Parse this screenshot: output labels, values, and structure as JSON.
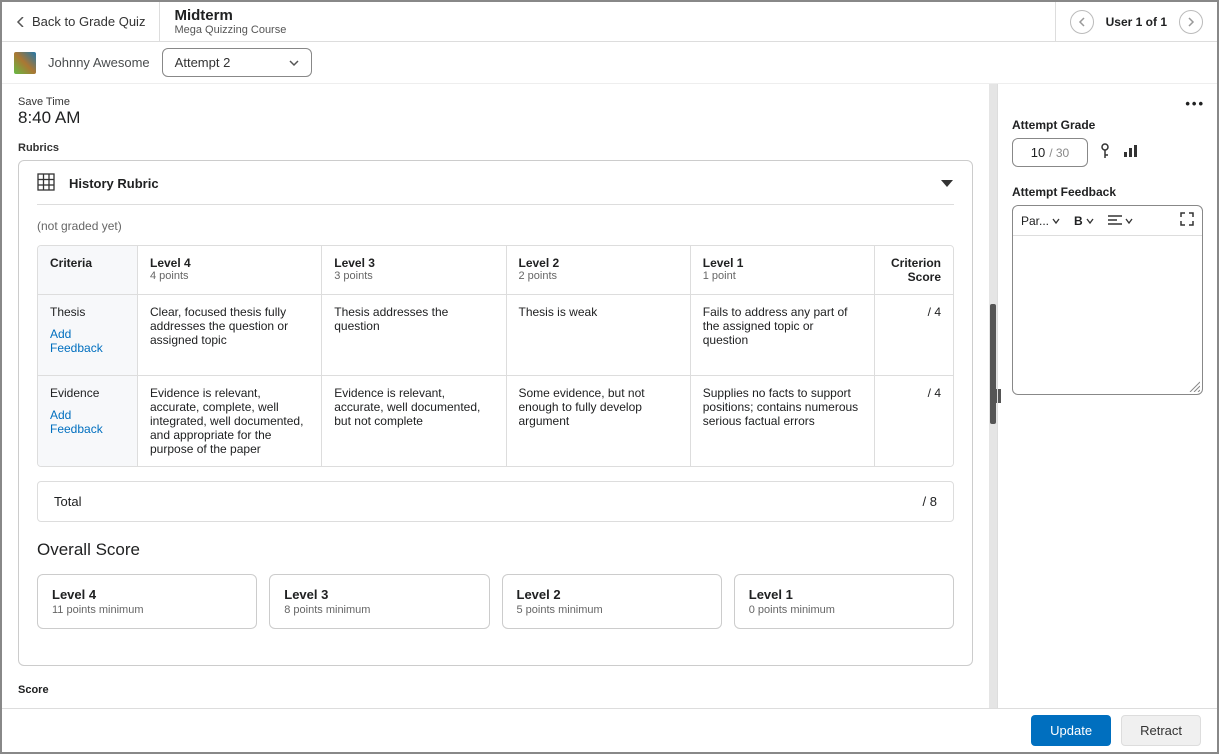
{
  "header": {
    "back": "Back to Grade Quiz",
    "title": "Midterm",
    "subtitle": "Mega Quizzing Course",
    "user_nav": "User 1 of 1"
  },
  "student": {
    "name": "Johnny Awesome",
    "attempt": "Attempt 2"
  },
  "save": {
    "label": "Save Time",
    "time": "8:40 AM"
  },
  "rubrics": {
    "label": "Rubrics",
    "title": "History Rubric",
    "not_graded": "(not graded yet)",
    "headers": {
      "criteria": "Criteria",
      "score": "Criterion Score",
      "levels": [
        {
          "name": "Level 4",
          "pts": "4 points"
        },
        {
          "name": "Level 3",
          "pts": "3 points"
        },
        {
          "name": "Level 2",
          "pts": "2 points"
        },
        {
          "name": "Level 1",
          "pts": "1 point"
        }
      ]
    },
    "add_feedback": "Add Feedback",
    "rows": [
      {
        "criterion": "Thesis",
        "cells": [
          "Clear, focused thesis fully addresses the question or assigned topic",
          "Thesis addresses the question",
          "Thesis is weak",
          "Fails to address any part of the assigned topic or question"
        ],
        "score": "/ 4"
      },
      {
        "criterion": "Evidence",
        "cells": [
          "Evidence is relevant, accurate, complete, well integrated, well documented, and appropriate for the purpose of the paper",
          "Evidence is relevant, accurate, well documented, but not complete",
          "Some evidence, but not enough to fully develop argument",
          "Supplies no facts to support positions; contains numerous serious factual errors"
        ],
        "score": "/ 4"
      }
    ],
    "total": {
      "label": "Total",
      "value": "/ 8"
    }
  },
  "overall": {
    "title": "Overall Score",
    "levels": [
      {
        "name": "Level 4",
        "pts": "11 points minimum"
      },
      {
        "name": "Level 3",
        "pts": "8 points minimum"
      },
      {
        "name": "Level 2",
        "pts": "5 points minimum"
      },
      {
        "name": "Level 1",
        "pts": "0 points minimum"
      }
    ],
    "score_label": "Score"
  },
  "right": {
    "grade_label": "Attempt Grade",
    "grade_value": "10",
    "grade_max": "/ 30",
    "feedback_label": "Attempt Feedback",
    "para": "Par..."
  },
  "footer": {
    "update": "Update",
    "retract": "Retract"
  }
}
